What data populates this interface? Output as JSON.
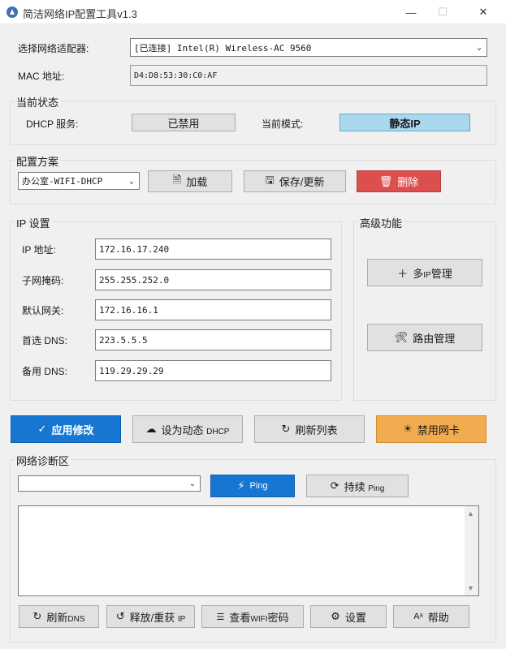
{
  "window": {
    "title": "简洁网络IP配置工具v1.3",
    "minimize": "—",
    "maximize": "☐",
    "close": "✕"
  },
  "adapter": {
    "label": "选择网络适配器:",
    "selected": "[已连接] Intel(R) Wireless-AC 9560",
    "mac_label": "MAC 地址:",
    "mac_value": "D4:D8:53:30:C0:AF"
  },
  "status": {
    "group_title": "当前状态",
    "dhcp_label": "DHCP 服务:",
    "dhcp_value": "已禁用",
    "mode_label": "当前模式:",
    "mode_value": "静态IP"
  },
  "profile": {
    "group_title": "配置方案",
    "selected": "办公室-WIFI-DHCP",
    "load": "加载",
    "save": "保存/更新",
    "delete": "删除"
  },
  "ip": {
    "group_title": "IP 设置",
    "fields": [
      {
        "label": "IP 地址:",
        "value": "172.16.17.240"
      },
      {
        "label": "子网掩码:",
        "value": "255.255.252.0"
      },
      {
        "label": "默认网关:",
        "value": "172.16.16.1"
      },
      {
        "label": "首选 DNS:",
        "value": "223.5.5.5"
      },
      {
        "label": "备用 DNS:",
        "value": "119.29.29.29"
      }
    ]
  },
  "advanced": {
    "group_title": "高级功能",
    "multi_ip": {
      "prefix": "多",
      "small": "IP",
      "suffix": "管理"
    },
    "route": "路由管理"
  },
  "actions": {
    "apply": "应用修改",
    "dynamic": {
      "main": "设为动态",
      "small": "DHCP"
    },
    "refresh": "刷新列表",
    "disable_nic": "禁用网卡"
  },
  "diag": {
    "group_title": "网络诊断区",
    "target": "",
    "ping": "Ping",
    "continuous": {
      "main": "持续",
      "small": "Ping"
    },
    "output": ""
  },
  "bottom": {
    "refresh_dns": {
      "main": "刷新",
      "small": "DNS"
    },
    "release_renew": {
      "main": "释放/重获",
      "small": "IP"
    },
    "view_wifi": {
      "main": "查看",
      "small": "WIFI",
      "suffix": "密码"
    },
    "settings": "设置",
    "help": "帮助"
  },
  "colors": {
    "primary": "#1876d3",
    "warning": "#f2ab4e",
    "danger": "#dd4f4f",
    "mode_badge": "#a9d7ee"
  }
}
